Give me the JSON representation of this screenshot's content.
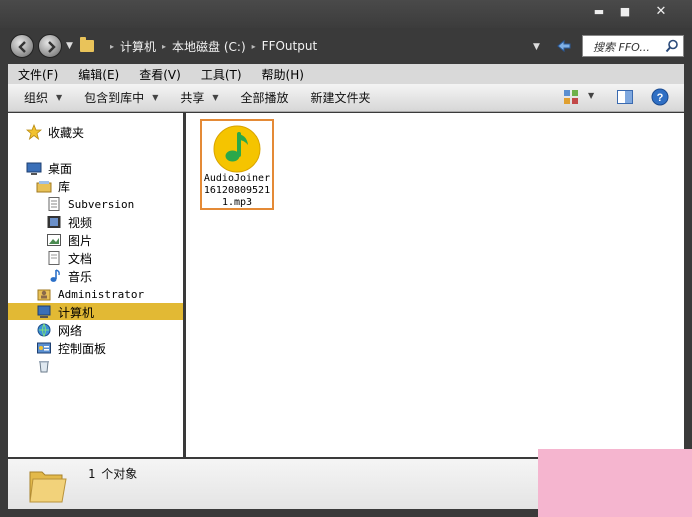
{
  "window": {
    "minimize_glyph": "▬",
    "maximize_glyph": "■",
    "close_glyph": "✕"
  },
  "address": {
    "crumbs": [
      "计算机",
      "本地磁盘 (C:)",
      "FFOutput"
    ],
    "separator": "▸",
    "search_placeholder": "搜索 FFO..."
  },
  "menu": [
    "文件(F)",
    "编辑(E)",
    "查看(V)",
    "工具(T)",
    "帮助(H)"
  ],
  "toolbar": {
    "organize": "组织",
    "include_in_library": "包含到库中",
    "share": "共享",
    "play_all": "全部播放",
    "new_folder": "新建文件夹",
    "dropdown_glyph": "▼"
  },
  "nav": {
    "favorites": "收藏夹",
    "desktop": "桌面",
    "libraries": "库",
    "subversion": "Subversion",
    "videos": "视频",
    "pictures": "图片",
    "documents": "文档",
    "music": "音乐",
    "administrator": "Administrator",
    "computer": "计算机",
    "network": "网络",
    "control_panel": "控制面板"
  },
  "files": [
    {
      "name": "AudioJoiner161208095211.mp3"
    }
  ],
  "status": {
    "count": "1",
    "text": "个对象"
  },
  "colors": {
    "selected_nav": "#e2b934",
    "file_highlight": "#e48a36",
    "music_icon_yellow": "#f5c400",
    "music_note_green": "#2aa84a"
  }
}
